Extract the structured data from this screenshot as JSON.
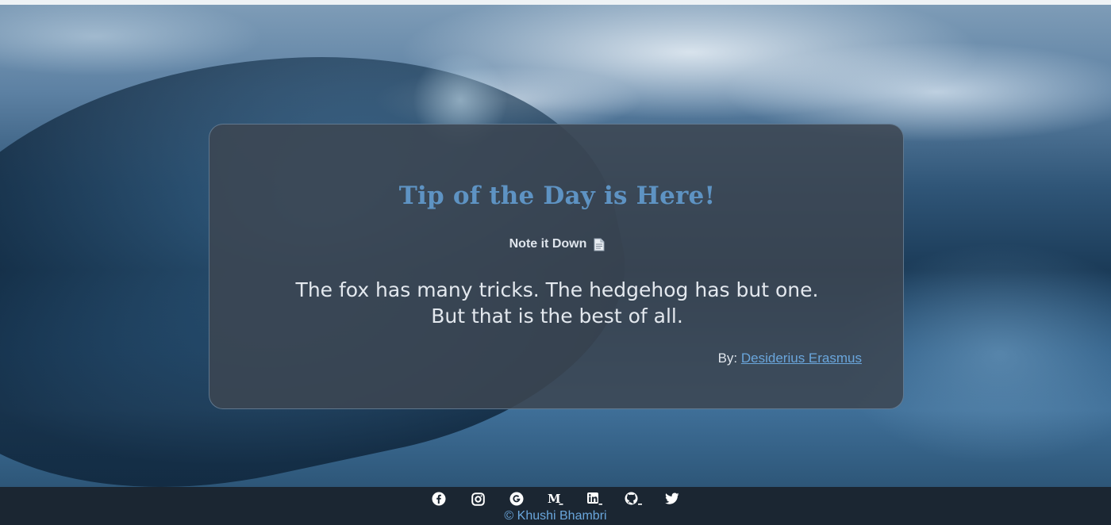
{
  "card": {
    "title": "Tip of the Day is Here!",
    "note_label": "Note it Down",
    "note_icon": "document-icon",
    "quote_line1": "The fox has many tricks. The hedgehog has but one.",
    "quote_line2": "But that is the best of all.",
    "by_label": "By:",
    "author": "Desiderius Erasmus"
  },
  "footer": {
    "social_icons": [
      "facebook-icon",
      "instagram-icon",
      "google-icon",
      "medium-icon",
      "linkedin-icon",
      "github-icon",
      "twitter-icon"
    ],
    "copyright": "© Khushi Bhambri"
  },
  "colors": {
    "title": "#5e93c3",
    "link": "#6aa6dc",
    "card_bg": "#3c4652",
    "footer_bg": "#1b2632"
  }
}
